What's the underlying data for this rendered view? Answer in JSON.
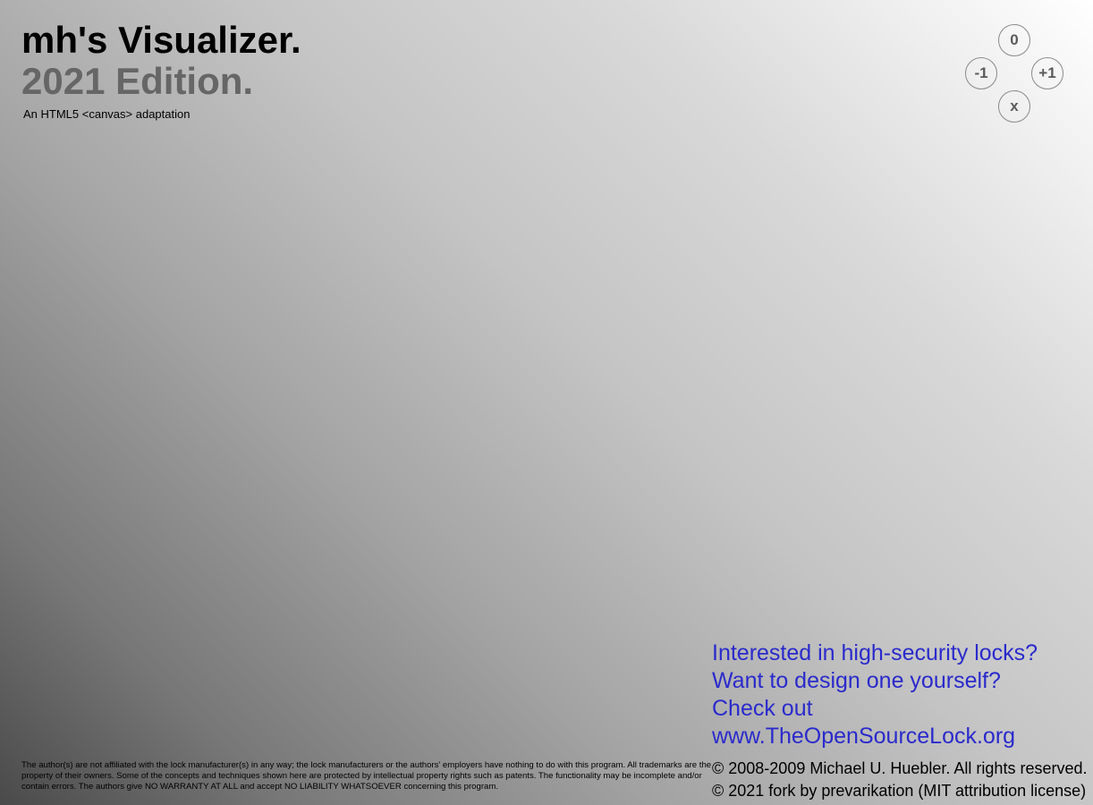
{
  "header": {
    "title": "mh's Visualizer.",
    "subtitle": "2021 Edition.",
    "tagline": "An HTML5 <canvas> adaptation"
  },
  "controls": {
    "zero_label": "0",
    "minus_label": "-1",
    "plus_label": "+1",
    "close_label": "x"
  },
  "promo": {
    "line1": "Interested in high-security locks?",
    "line2": "Want to design one yourself?",
    "line3": "Check out",
    "link": "www.TheOpenSourceLock.org"
  },
  "copyright": {
    "line1": "© 2008-2009 Michael U. Huebler. All rights reserved.",
    "line2": "© 2021 fork by prevarikation (MIT attribution license)"
  },
  "disclaimer": {
    "text": "The author(s) are not affiliated with the lock manufacturer(s) in any way; the lock manufacturers or the authors' employers have nothing to do with this program. All trademarks are the property of their owners. Some of the concepts and techniques shown here are protected by intellectual property rights such as patents. The functionality may be incomplete and/or contain errors. The authors give NO WARRANTY AT ALL and accept NO LIABILITY WHATSOEVER concerning this program."
  },
  "colors": {
    "link": "#2a2acc",
    "subtitle": "#666666",
    "control_text": "#5a5a5a"
  }
}
